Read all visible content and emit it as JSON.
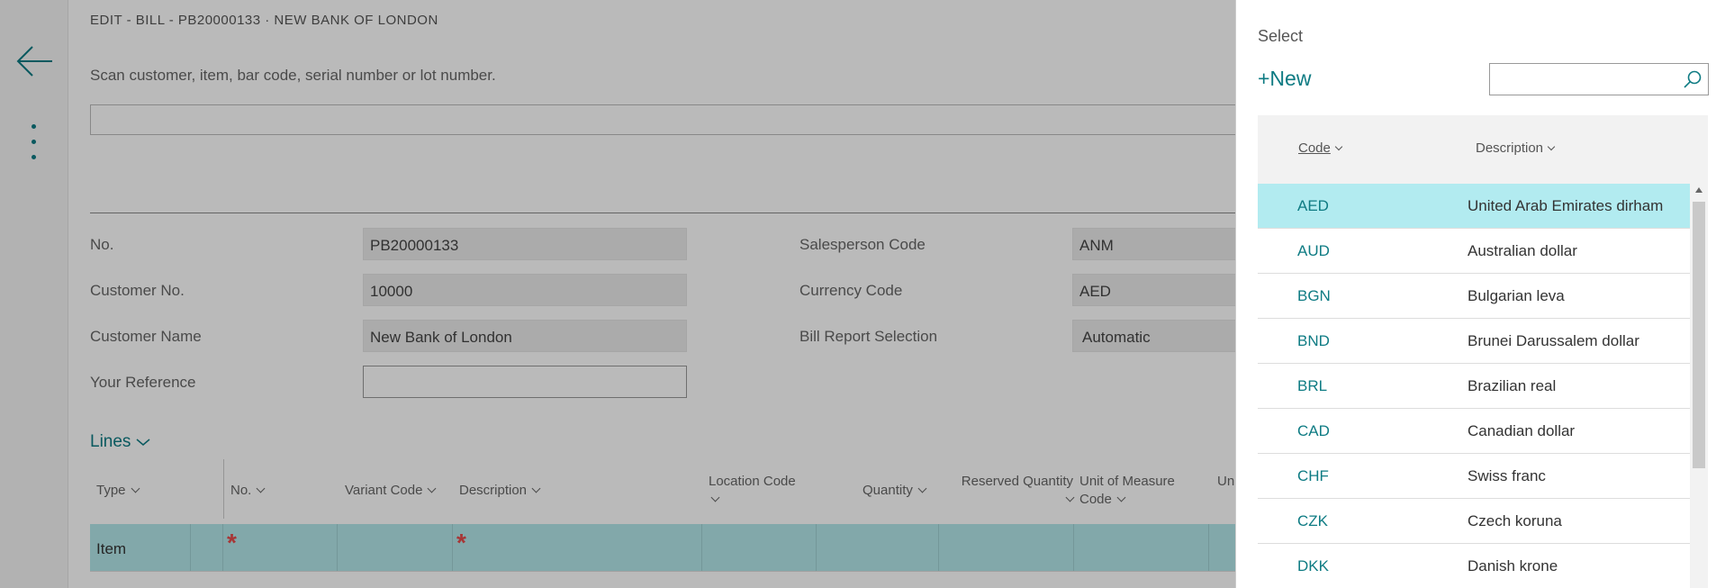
{
  "page": {
    "title": "EDIT - BILL - PB20000133 · NEW BANK OF LONDON",
    "scan_hint": "Scan customer, item, bar code, serial number or lot number."
  },
  "header_fields": {
    "no": {
      "label": "No.",
      "value": "PB20000133"
    },
    "customer_no": {
      "label": "Customer No.",
      "value": "10000"
    },
    "customer_name": {
      "label": "Customer Name",
      "value": "New Bank of London"
    },
    "your_reference": {
      "label": "Your Reference",
      "value": ""
    },
    "salesperson_code": {
      "label": "Salesperson Code",
      "value": "ANM"
    },
    "currency_code": {
      "label": "Currency Code",
      "value": "AED"
    },
    "bill_report_selection": {
      "label": "Bill Report Selection",
      "value": "Automatic"
    }
  },
  "lines": {
    "title": "Lines",
    "columns": {
      "type": "Type",
      "no": "No.",
      "variant_code": "Variant Code",
      "description": "Description",
      "location_code": "Location Code",
      "quantity": "Quantity",
      "reserved_quantity": "Reserved Quantity",
      "unit_of_measure_code_1": "Unit of Measure",
      "unit_of_measure_code_2": "Code",
      "truncated": "Un"
    },
    "row": {
      "type": "Item",
      "required_mark": "*"
    }
  },
  "lookup": {
    "title": "Select",
    "new_label": "+New",
    "search_placeholder": "",
    "columns": {
      "code": "Code",
      "description": "Description"
    },
    "rows": [
      {
        "code": "AED",
        "description": "United Arab Emirates dirham",
        "selected": true
      },
      {
        "code": "AUD",
        "description": "Australian dollar"
      },
      {
        "code": "BGN",
        "description": "Bulgarian leva"
      },
      {
        "code": "BND",
        "description": "Brunei Darussalem dollar"
      },
      {
        "code": "BRL",
        "description": "Brazilian real"
      },
      {
        "code": "CAD",
        "description": "Canadian dollar"
      },
      {
        "code": "CHF",
        "description": "Swiss franc"
      },
      {
        "code": "CZK",
        "description": "Czech koruna"
      },
      {
        "code": "DKK",
        "description": "Danish krone"
      }
    ]
  },
  "colors": {
    "accent": "#0e7b83",
    "selected_row": "#b2ebf0",
    "required": "#e54b4b",
    "dim_overlay": "rgba(0,0,0,0.27)"
  },
  "icons": [
    "back-arrow-icon",
    "more-options-icon",
    "chevron-down-icon",
    "search-icon",
    "scroll-up-icon"
  ]
}
